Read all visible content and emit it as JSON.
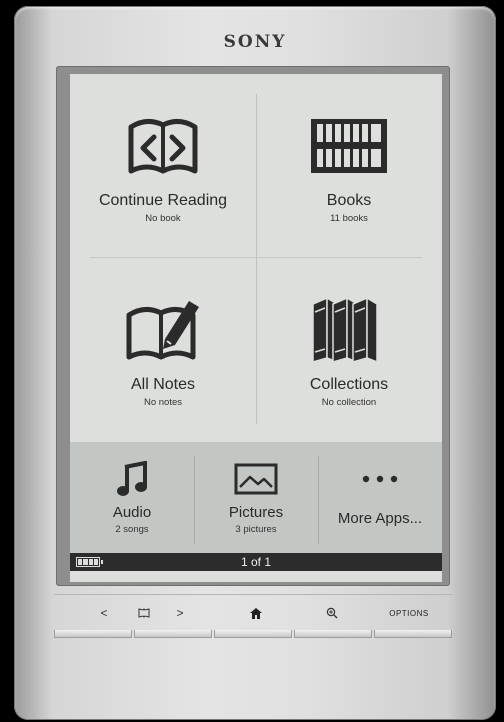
{
  "device": {
    "brand": "SONY"
  },
  "home": {
    "tiles": [
      {
        "label": "Continue Reading",
        "sub": "No book",
        "icon": "open-book-arrows-icon"
      },
      {
        "label": "Books",
        "sub": "11 books",
        "icon": "bookshelf-icon"
      },
      {
        "label": "All Notes",
        "sub": "No notes",
        "icon": "book-pen-icon"
      },
      {
        "label": "Collections",
        "sub": "No collection",
        "icon": "standing-books-icon"
      }
    ],
    "apps": [
      {
        "label": "Audio",
        "sub": "2 songs",
        "icon": "music-note-icon"
      },
      {
        "label": "Pictures",
        "sub": "3 pictures",
        "icon": "picture-icon"
      },
      {
        "label": "More Apps...",
        "sub": "",
        "icon": "more-dots-icon"
      }
    ]
  },
  "status": {
    "page": "1 of 1",
    "battery_icon": "battery-icon"
  },
  "buttons": {
    "prev": "<",
    "next": ">",
    "home_icon": "home-icon",
    "bookmark_icon": "bookmark-icon",
    "zoom_icon": "zoom-icon",
    "options": "OPTIONS"
  }
}
